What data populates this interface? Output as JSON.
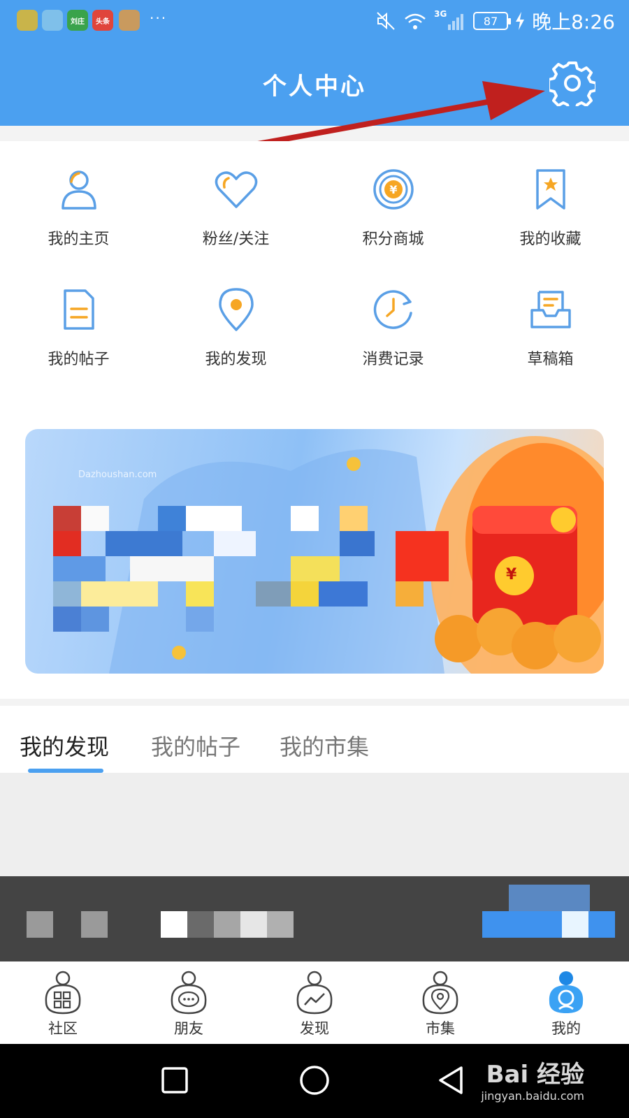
{
  "status_bar": {
    "app_icons": [
      "app-1",
      "app-2",
      "刘庄",
      "头条",
      "app-5"
    ],
    "more": "···",
    "signal": "3G",
    "battery": "87",
    "time": "晚上8:26"
  },
  "header": {
    "title": "个人中心",
    "settings_icon": "gear-icon"
  },
  "menu": [
    {
      "label": "我的主页",
      "icon": "user-icon"
    },
    {
      "label": "粉丝/关注",
      "icon": "heart-icon"
    },
    {
      "label": "积分商城",
      "icon": "yen-coin-icon"
    },
    {
      "label": "我的收藏",
      "icon": "bookmark-star-icon"
    },
    {
      "label": "我的帖子",
      "icon": "document-icon"
    },
    {
      "label": "我的发现",
      "icon": "location-pin-icon"
    },
    {
      "label": "消费记录",
      "icon": "clock-icon"
    },
    {
      "label": "草稿箱",
      "icon": "inbox-tray-icon"
    }
  ],
  "banner": {
    "site": "Dazhoushan.com",
    "symbol": "¥"
  },
  "tabs": [
    {
      "label": "我的发现",
      "active": true
    },
    {
      "label": "我的帖子",
      "active": false
    },
    {
      "label": "我的市集",
      "active": false
    }
  ],
  "bottom_nav": [
    {
      "label": "社区",
      "icon": "community-icon",
      "active": false
    },
    {
      "label": "朋友",
      "icon": "chat-bubble-icon",
      "active": false
    },
    {
      "label": "发现",
      "icon": "trend-icon",
      "active": false
    },
    {
      "label": "市集",
      "icon": "market-pin-icon",
      "active": false
    },
    {
      "label": "我的",
      "icon": "profile-icon",
      "active": true
    }
  ],
  "watermark": {
    "brand": "Bai 经验",
    "url": "jingyan.baidu.com"
  },
  "colors": {
    "primary": "#4ba0f0",
    "icon_blue": "#5a9fe6",
    "accent_orange": "#f6a623",
    "arrow_red": "#c0201e"
  }
}
